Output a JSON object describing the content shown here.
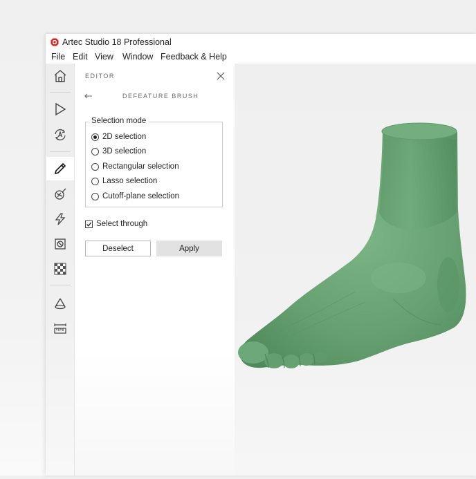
{
  "app": {
    "title": "Artec Studio 18 Professional",
    "logo_icon": "artec-logo-icon",
    "logo_color": "#e2231a"
  },
  "menubar": {
    "items": [
      "File",
      "Edit",
      "View",
      "Window",
      "Feedback & Help"
    ]
  },
  "toolbar": {
    "tools": [
      {
        "name": "home-icon",
        "active": false
      },
      {
        "name": "play-icon",
        "active": false
      },
      {
        "name": "autopilot-icon",
        "active": false
      },
      {
        "name": "pencil-icon",
        "active": true
      },
      {
        "name": "brush-icon",
        "active": false
      },
      {
        "name": "lightning-icon",
        "active": false
      },
      {
        "name": "mask-icon",
        "active": false
      },
      {
        "name": "texture-icon",
        "active": false
      },
      {
        "name": "measure-cone-icon",
        "active": false
      },
      {
        "name": "ruler-icon",
        "active": false
      }
    ]
  },
  "panel": {
    "editor_label": "EDITOR",
    "subtitle": "DEFEATURE BRUSH",
    "selection_mode": {
      "legend": "Selection mode",
      "options": [
        "2D selection",
        "3D selection",
        "Rectangular selection",
        "Lasso selection",
        "Cutoff-plane selection"
      ],
      "selected": "2D selection"
    },
    "select_through": {
      "label": "Select through",
      "checked": true
    },
    "deselect_label": "Deselect",
    "apply_label": "Apply"
  },
  "viewport": {
    "model": "foot-3d-scan",
    "model_color": "#6aa475"
  }
}
